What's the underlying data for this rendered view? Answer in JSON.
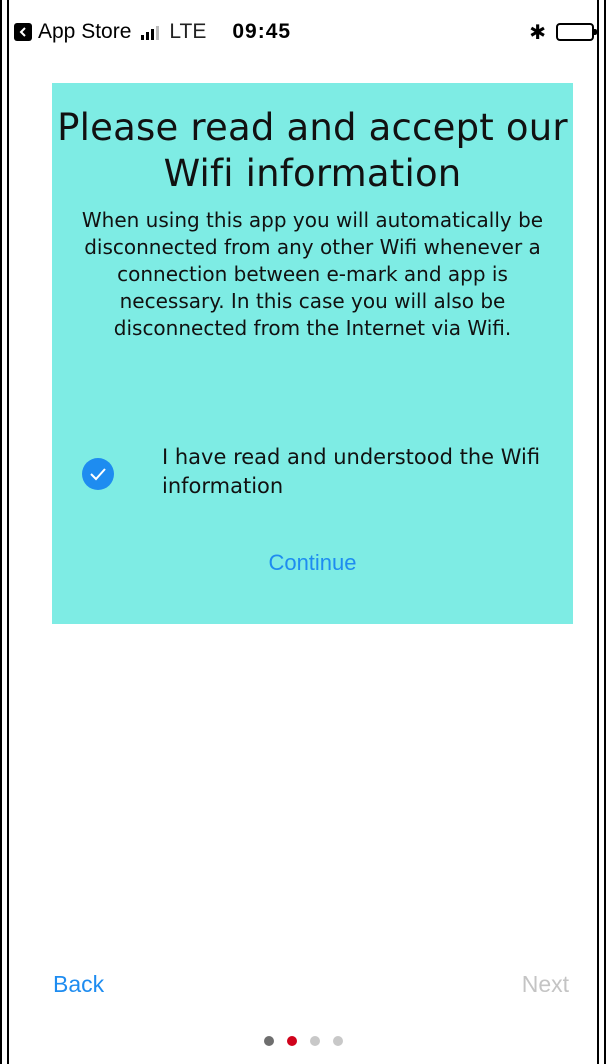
{
  "status_bar": {
    "back_app": "App Store",
    "network": "LTE",
    "time": "09:45",
    "icons": [
      "back-app-icon",
      "signal-icon",
      "bluetooth-icon",
      "battery-icon"
    ]
  },
  "card": {
    "background": "#7EECE4",
    "title": "Please read and accept our Wifi information",
    "body": "When using this app you will automatically be disconnected from any other Wifi whenever a connection between e-mark and app is necessary. In this case you will also be disconnected from the Internet via Wifi.",
    "checkbox_checked": true,
    "checkbox_label": "I have read and understood the Wifi information",
    "continue_label": "Continue"
  },
  "footer": {
    "back_label": "Back",
    "next_label": "Next",
    "next_enabled": false,
    "page_count": 4,
    "current_page": 2
  },
  "colors": {
    "accent": "#1E8CF0",
    "pager_active": "#D0021B",
    "pager_first": "#6E6E6E",
    "pager_inactive": "#C8C8C8",
    "disabled": "#C4C4C4"
  }
}
